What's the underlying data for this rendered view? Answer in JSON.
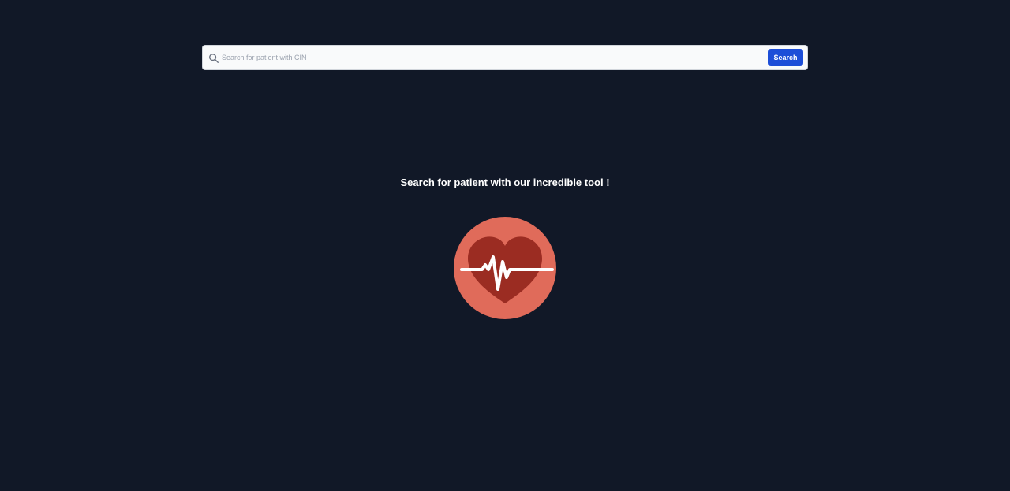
{
  "search": {
    "placeholder": "Search for patient with CIN",
    "value": "",
    "button_label": "Search"
  },
  "hero": {
    "title": "Search for patient with our incredible tool !"
  },
  "icons": {
    "search": "search-icon",
    "logo": "heart-pulse-icon"
  },
  "colors": {
    "background": "#111827",
    "accent": "#1d4ed8",
    "logo_circle": "#e06b5a",
    "logo_heart": "#9b2c22"
  }
}
